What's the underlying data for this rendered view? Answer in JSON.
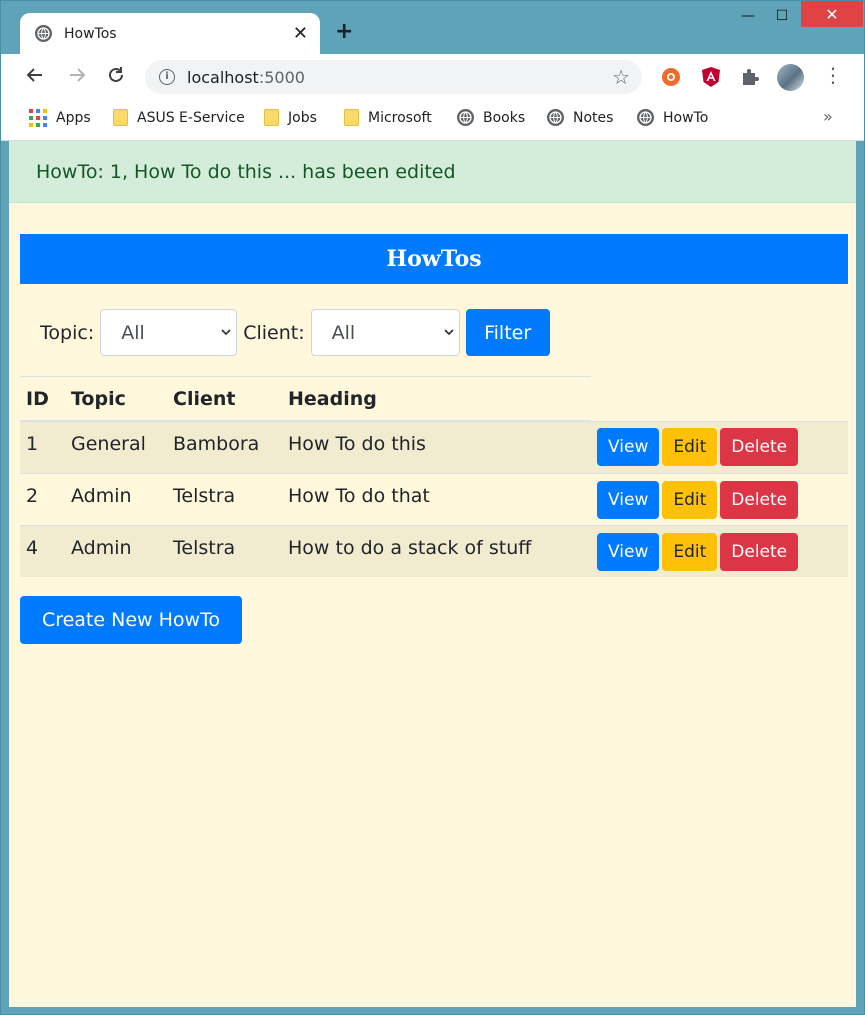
{
  "browser": {
    "tab": {
      "title": "HowTos",
      "close": "✕"
    },
    "new_tab": "+",
    "window_controls": {
      "minimize": "—",
      "maximize": "☐",
      "close": "✕"
    },
    "address": {
      "host": "localhost",
      "port": ":5000"
    },
    "bookmarks": [
      {
        "label": "Apps",
        "icon": "apps-grid-icon"
      },
      {
        "label": "ASUS E-Service",
        "icon": "folder-icon"
      },
      {
        "label": "Jobs",
        "icon": "folder-icon"
      },
      {
        "label": "Microsoft",
        "icon": "folder-icon"
      },
      {
        "label": "Books",
        "icon": "globe-icon"
      },
      {
        "label": "Notes",
        "icon": "globe-icon"
      },
      {
        "label": "HowTo",
        "icon": "globe-icon"
      }
    ],
    "bookmarks_more": "»"
  },
  "page": {
    "alert": "HowTo: 1, How To do this ... has been edited",
    "title": "HowTos",
    "filters": {
      "topic_label": "Topic:",
      "topic_value": "All",
      "client_label": "Client:",
      "client_value": "All",
      "filter_button": "Filter"
    },
    "table": {
      "headers": [
        "ID",
        "Topic",
        "Client",
        "Heading"
      ],
      "rows": [
        {
          "id": "1",
          "topic": "General",
          "client": "Bambora",
          "heading": "How To do this"
        },
        {
          "id": "2",
          "topic": "Admin",
          "client": "Telstra",
          "heading": "How To do that"
        },
        {
          "id": "4",
          "topic": "Admin",
          "client": "Telstra",
          "heading": "How to do a stack of stuff"
        }
      ],
      "actions": {
        "view": "View",
        "edit": "Edit",
        "delete": "Delete"
      }
    },
    "create_button": "Create New HowTo"
  },
  "colors": {
    "primary": "#007bff",
    "warning": "#ffc107",
    "danger": "#dc3545",
    "alert_bg": "#d4edda",
    "page_bg": "#fff8dc"
  }
}
